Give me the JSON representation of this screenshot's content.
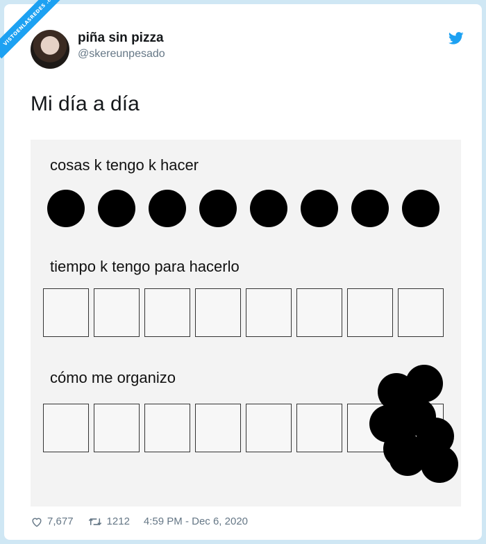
{
  "badge_text": "VISTOENLASREDES .com",
  "user": {
    "display_name": "piña sin pizza",
    "handle": "@skereunpesado"
  },
  "tweet": {
    "text": "Mi día a día"
  },
  "meme": {
    "label_1": "cosas k tengo k hacer",
    "label_2": "tiempo k tengo para hacerlo",
    "label_3": "cómo me organizo",
    "task_dots": 8,
    "time_boxes": 8
  },
  "stats": {
    "likes": "7,677",
    "retweets": "1212",
    "timestamp": "4:59 PM - Dec 6, 2020"
  },
  "icons": {
    "bird": "twitter-bird-icon",
    "heart": "heart-icon",
    "retweet": "retweet-icon"
  },
  "colors": {
    "accent": "#1da1f2",
    "muted": "#657786",
    "background": "#cfe7f4"
  }
}
